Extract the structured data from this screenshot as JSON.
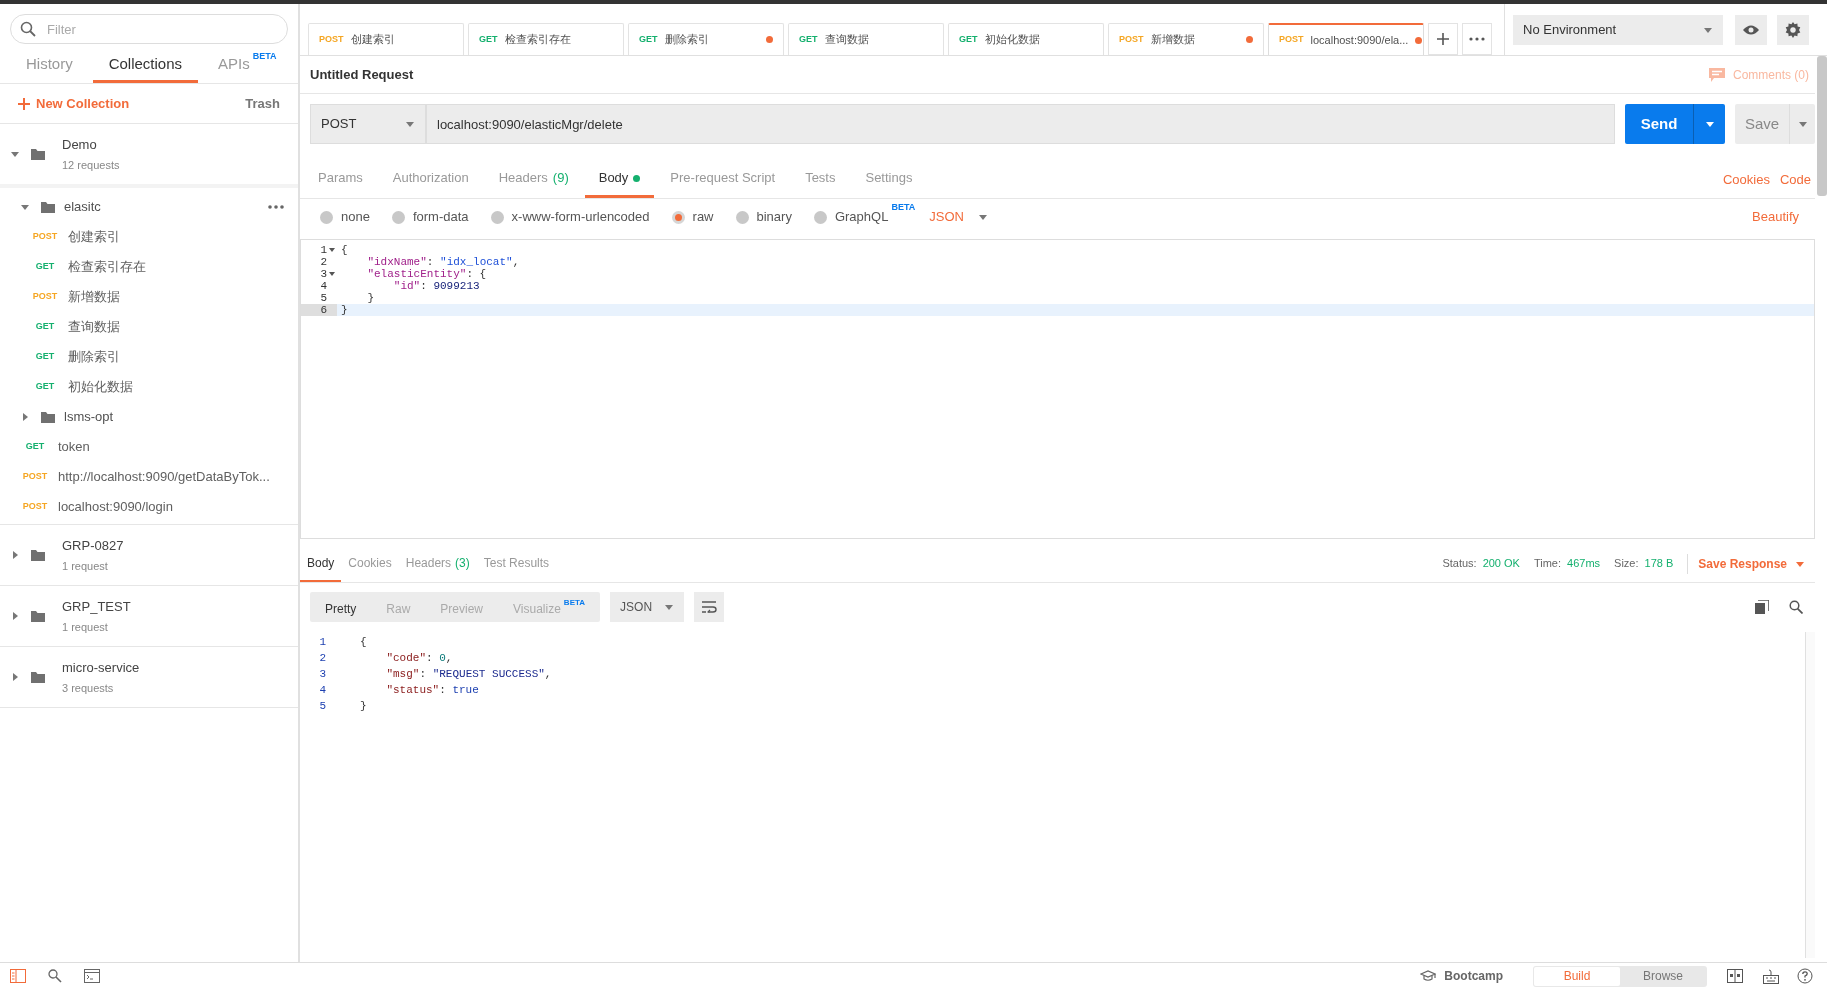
{
  "sidebar": {
    "filter_placeholder": "Filter",
    "tabs": [
      {
        "label": "History",
        "selected": false
      },
      {
        "label": "Collections",
        "selected": true
      },
      {
        "label": "APIs",
        "badge": "BETA",
        "selected": false
      }
    ],
    "new_collection": "New Collection",
    "trash": "Trash",
    "collections": [
      {
        "name": "Demo",
        "count": "12 requests",
        "expanded": true,
        "children": [
          {
            "kind": "folder",
            "name": "elasitc",
            "expanded": true,
            "children": [
              {
                "kind": "request",
                "method": "POST",
                "color": "#f5a623",
                "name": "创建索引"
              },
              {
                "kind": "request",
                "method": "GET",
                "color": "#14b06e",
                "name": "检查索引存在"
              },
              {
                "kind": "request",
                "method": "POST",
                "color": "#f5a623",
                "name": "新增数据"
              },
              {
                "kind": "request",
                "method": "GET",
                "color": "#14b06e",
                "name": "查询数据"
              },
              {
                "kind": "request",
                "method": "GET",
                "color": "#14b06e",
                "name": "删除索引"
              },
              {
                "kind": "request",
                "method": "GET",
                "color": "#14b06e",
                "name": "初始化数据"
              }
            ]
          },
          {
            "kind": "folder",
            "name": "lsms-opt",
            "expanded": false
          },
          {
            "kind": "request",
            "method": "GET",
            "color": "#14b06e",
            "name": "token"
          },
          {
            "kind": "request",
            "method": "POST",
            "color": "#f5a623",
            "name": "http://localhost:9090/getDataByTok..."
          },
          {
            "kind": "request",
            "method": "POST",
            "color": "#f5a623",
            "name": "localhost:9090/login"
          }
        ]
      },
      {
        "name": "GRP-0827",
        "count": "1 request",
        "expanded": false
      },
      {
        "name": "GRP_TEST",
        "count": "1 request",
        "expanded": false
      },
      {
        "name": "micro-service",
        "count": "3 requests",
        "expanded": false
      }
    ]
  },
  "open_tabs": [
    {
      "method": "POST",
      "color": "#f5a623",
      "name": "创建索引",
      "unsaved": false,
      "selected": false
    },
    {
      "method": "GET",
      "color": "#14b06e",
      "name": "检查索引存在",
      "unsaved": false,
      "selected": false
    },
    {
      "method": "GET",
      "color": "#14b06e",
      "name": "删除索引",
      "unsaved": true,
      "selected": false
    },
    {
      "method": "GET",
      "color": "#14b06e",
      "name": "查询数据",
      "unsaved": false,
      "selected": false
    },
    {
      "method": "GET",
      "color": "#14b06e",
      "name": "初始化数据",
      "unsaved": false,
      "selected": false
    },
    {
      "method": "POST",
      "color": "#f5a623",
      "name": "新增数据",
      "unsaved": true,
      "selected": false
    },
    {
      "method": "POST",
      "color": "#f5a623",
      "name": "localhost:9090/ela...",
      "unsaved": true,
      "selected": true
    }
  ],
  "environment": "No Environment",
  "request": {
    "title": "Untitled Request",
    "comments": "Comments (0)",
    "method": "POST",
    "url": "localhost:9090/elasticMgr/delete",
    "send": "Send",
    "save": "Save",
    "tabs": [
      {
        "label": "Params",
        "selected": false
      },
      {
        "label": "Authorization",
        "selected": false
      },
      {
        "label": "Headers",
        "count": "(9)",
        "selected": false
      },
      {
        "label": "Body",
        "dot": true,
        "selected": true
      },
      {
        "label": "Pre-request Script",
        "selected": false
      },
      {
        "label": "Tests",
        "selected": false
      },
      {
        "label": "Settings",
        "selected": false
      }
    ],
    "links": [
      "Cookies",
      "Code"
    ],
    "body_types": [
      {
        "label": "none",
        "selected": false
      },
      {
        "label": "form-data",
        "selected": false
      },
      {
        "label": "x-www-form-urlencoded",
        "selected": false
      },
      {
        "label": "raw",
        "selected": true
      },
      {
        "label": "binary",
        "selected": false
      },
      {
        "label": "GraphQL",
        "badge": "BETA",
        "selected": false
      }
    ],
    "format": "JSON",
    "beautify": "Beautify",
    "code": [
      {
        "number": "1",
        "foldable": true,
        "highlighted": false,
        "tokens": [
          {
            "kind": "punct",
            "text": "{"
          }
        ]
      },
      {
        "number": "2",
        "foldable": false,
        "highlighted": false,
        "tokens": [
          {
            "kind": "key",
            "text": "    \"idxName\""
          },
          {
            "kind": "punct",
            "text": ": "
          },
          {
            "kind": "string",
            "text": "\"idx_locat\""
          },
          {
            "kind": "punct",
            "text": ","
          }
        ]
      },
      {
        "number": "3",
        "foldable": true,
        "highlighted": false,
        "tokens": [
          {
            "kind": "key",
            "text": "    \"elasticEntity\""
          },
          {
            "kind": "punct",
            "text": ": {"
          }
        ]
      },
      {
        "number": "4",
        "foldable": false,
        "highlighted": false,
        "tokens": [
          {
            "kind": "key",
            "text": "        \"id\""
          },
          {
            "kind": "punct",
            "text": ": "
          },
          {
            "kind": "number",
            "text": "9099213"
          }
        ]
      },
      {
        "number": "5",
        "foldable": false,
        "highlighted": false,
        "tokens": [
          {
            "kind": "punct",
            "text": "    }"
          }
        ]
      },
      {
        "number": "6",
        "foldable": false,
        "highlighted": true,
        "tokens": [
          {
            "kind": "punct",
            "text": "}"
          }
        ]
      }
    ]
  },
  "response": {
    "tabs": [
      {
        "label": "Body",
        "selected": true
      },
      {
        "label": "Cookies",
        "selected": false
      },
      {
        "label": "Headers",
        "count": "(3)",
        "selected": false
      },
      {
        "label": "Test Results",
        "selected": false
      }
    ],
    "status_label": "Status:",
    "status": "200 OK",
    "time_label": "Time:",
    "time": "467ms",
    "size_label": "Size:",
    "size": "178 B",
    "save_response": "Save Response",
    "views": [
      {
        "label": "Pretty",
        "selected": true
      },
      {
        "label": "Raw",
        "selected": false
      },
      {
        "label": "Preview",
        "selected": false
      },
      {
        "label": "Visualize",
        "badge": "BETA",
        "selected": false
      }
    ],
    "format": "JSON",
    "code": [
      {
        "number": "1",
        "tokens": [
          {
            "kind": "punct",
            "text": "{"
          }
        ]
      },
      {
        "number": "2",
        "tokens": [
          {
            "kind": "rkey",
            "text": "    \"code\""
          },
          {
            "kind": "punct",
            "text": ": "
          },
          {
            "kind": "rnumber",
            "text": "0"
          },
          {
            "kind": "punct",
            "text": ","
          }
        ]
      },
      {
        "number": "3",
        "tokens": [
          {
            "kind": "rkey",
            "text": "    \"msg\""
          },
          {
            "kind": "punct",
            "text": ": "
          },
          {
            "kind": "rstring",
            "text": "\"REQUEST SUCCESS\""
          },
          {
            "kind": "punct",
            "text": ","
          }
        ]
      },
      {
        "number": "4",
        "tokens": [
          {
            "kind": "rkey",
            "text": "    \"status\""
          },
          {
            "kind": "punct",
            "text": ": "
          },
          {
            "kind": "boolean",
            "text": "true"
          }
        ]
      },
      {
        "number": "5",
        "tokens": [
          {
            "kind": "punct",
            "text": "}"
          }
        ]
      }
    ]
  },
  "status_bar": {
    "bootcamp": "Bootcamp",
    "modes": [
      {
        "label": "Build",
        "selected": true
      },
      {
        "label": "Browse",
        "selected": false
      }
    ]
  }
}
